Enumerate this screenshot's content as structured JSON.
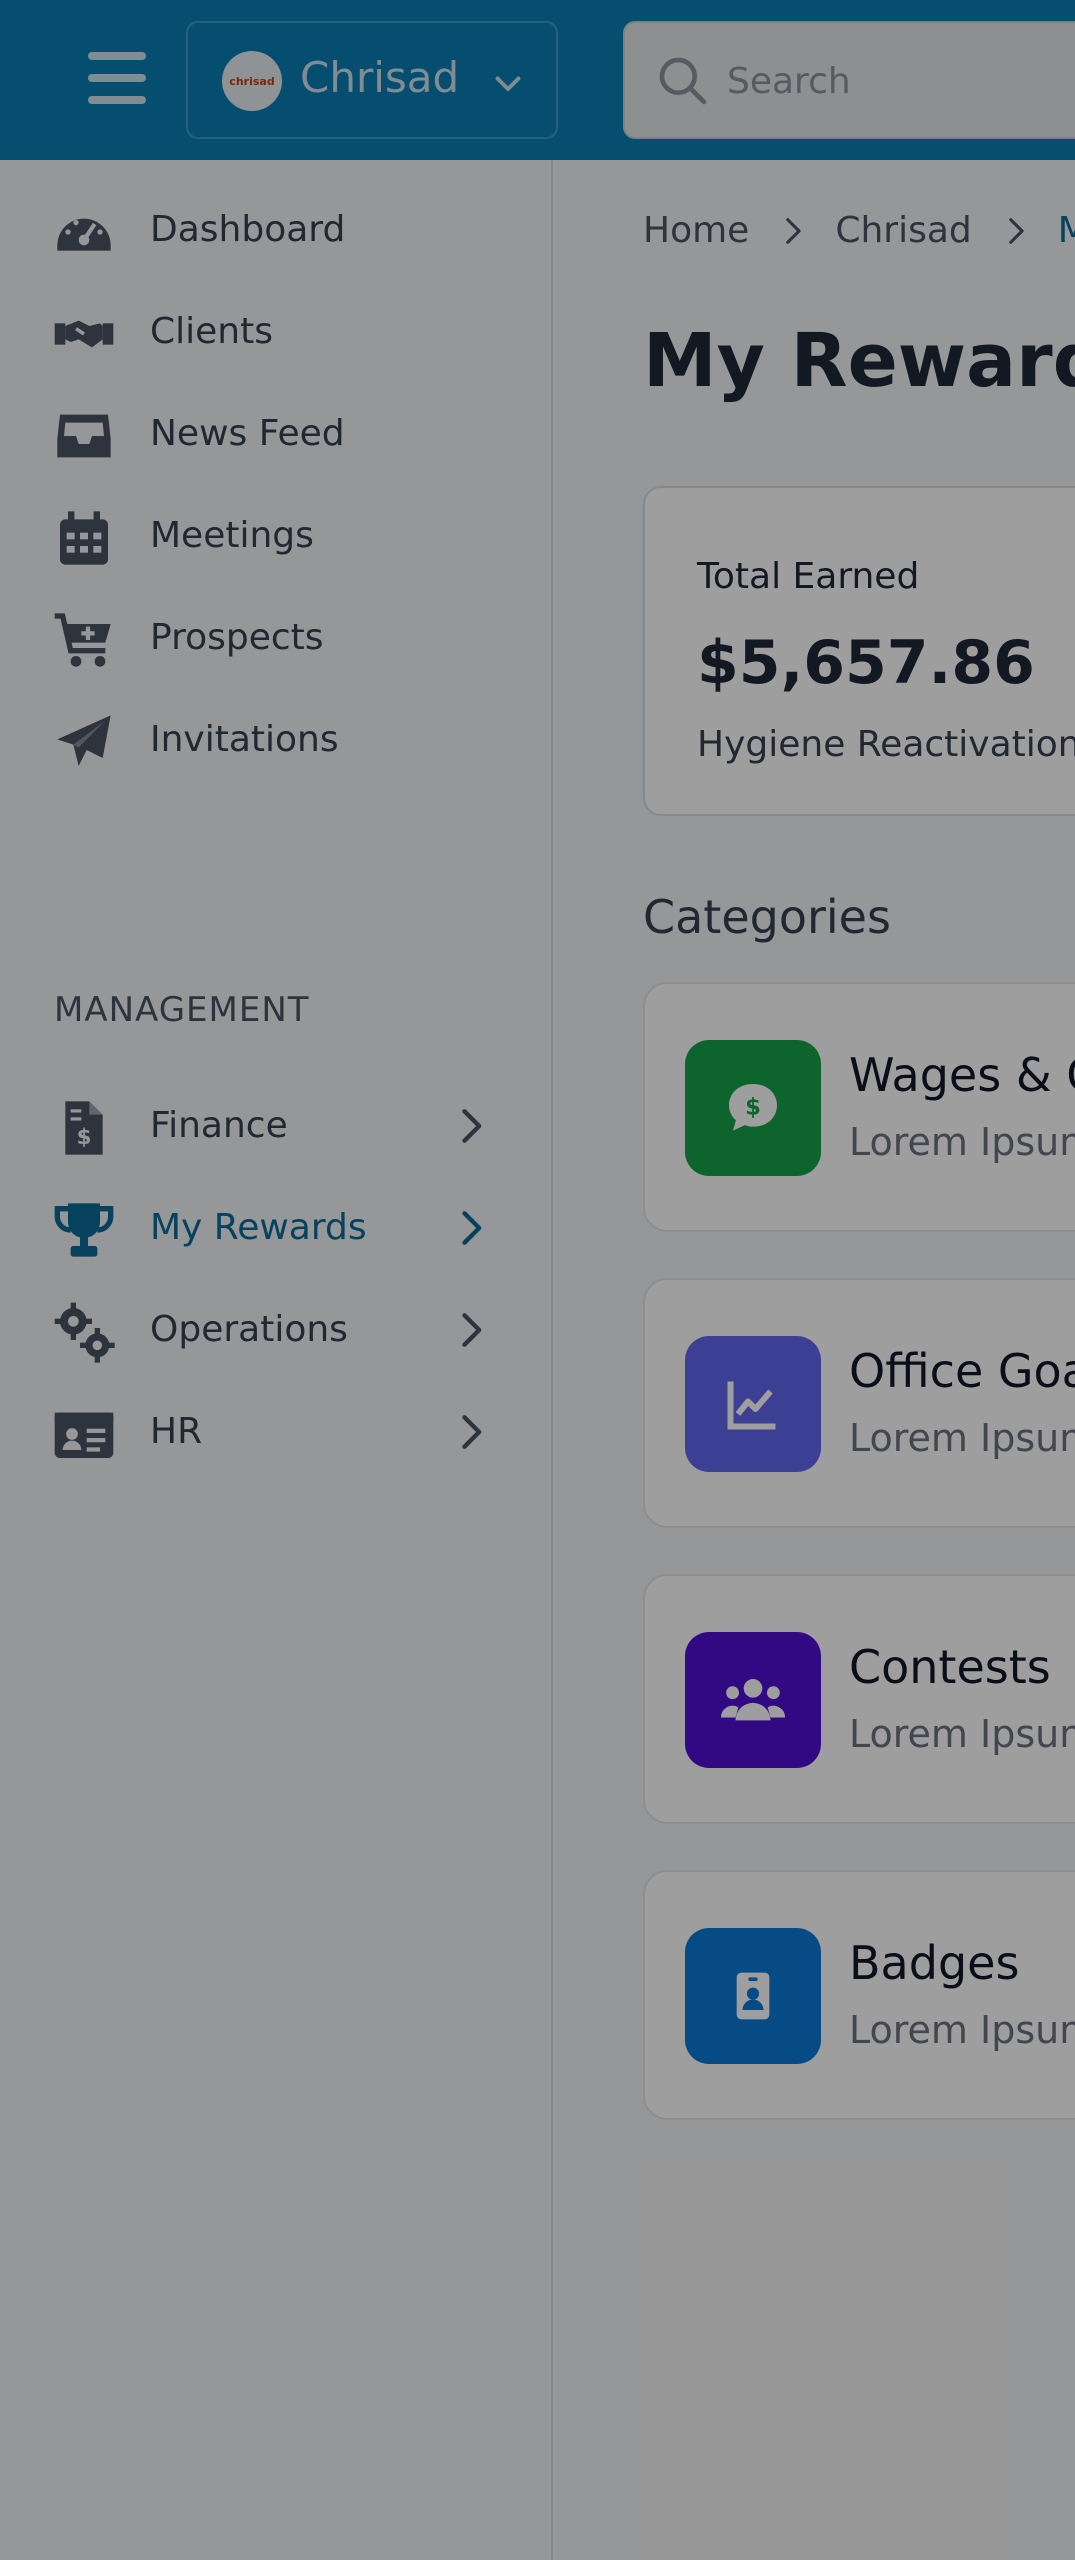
{
  "header": {
    "org_name": "Chrisad",
    "org_logo_text": "chrisad",
    "search_placeholder": "Search"
  },
  "sidebar": {
    "items": [
      {
        "label": "Dashboard",
        "icon": "gauge-icon"
      },
      {
        "label": "Clients",
        "icon": "handshake-icon"
      },
      {
        "label": "News Feed",
        "icon": "inbox-icon"
      },
      {
        "label": "Meetings",
        "icon": "calendar-icon"
      },
      {
        "label": "Prospects",
        "icon": "cart-plus-icon"
      },
      {
        "label": "Invitations",
        "icon": "paper-plane-icon"
      }
    ],
    "section_title": "MANAGEMENT",
    "management": [
      {
        "label": "Finance",
        "icon": "invoice-dollar-icon"
      },
      {
        "label": "My Rewards",
        "icon": "trophy-icon",
        "active": true
      },
      {
        "label": "Operations",
        "icon": "gears-icon"
      },
      {
        "label": "HR",
        "icon": "id-card-icon"
      }
    ]
  },
  "breadcrumb": [
    "Home",
    "Chrisad",
    "My Rewards"
  ],
  "page_title": "My Rewards",
  "earned": {
    "label": "Total Earned",
    "value": "$5,657.86",
    "sub": "Hygiene Reactivation"
  },
  "categories": {
    "title": "Categories",
    "items": [
      {
        "title": "Wages & Commissions",
        "desc": "Lorem Ipsum",
        "color": "#16a34a",
        "icon": "dollar-chat-icon"
      },
      {
        "title": "Office Goals",
        "desc": "Lorem Ipsum",
        "color": "#6366f1",
        "icon": "chart-line-icon"
      },
      {
        "title": "Contests",
        "desc": "Lorem Ipsum",
        "color": "#4f0fd4",
        "icon": "users-icon"
      },
      {
        "title": "Badges",
        "desc": "Lorem Ipsum",
        "color": "#0b78d8",
        "icon": "badge-icon"
      }
    ]
  },
  "colors": {
    "topbar": "#0a7fb3",
    "active": "#0a6a98"
  }
}
